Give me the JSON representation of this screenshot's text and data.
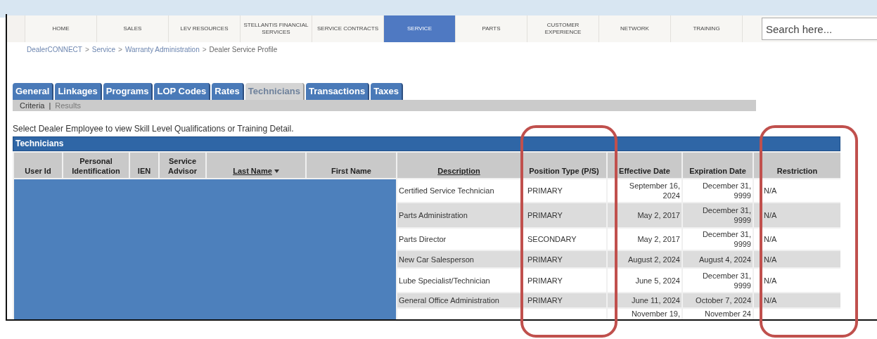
{
  "nav": {
    "items": [
      {
        "label": "HOME",
        "selected": false
      },
      {
        "label": "SALES",
        "selected": false
      },
      {
        "label": "LEV RESOURCES",
        "selected": false
      },
      {
        "label": "STELLANTIS FINANCIAL SERVICES",
        "selected": false
      },
      {
        "label": "SERVICE CONTRACTS",
        "selected": false
      },
      {
        "label": "SERVICE",
        "selected": true
      },
      {
        "label": "PARTS",
        "selected": false
      },
      {
        "label": "CUSTOMER EXPERIENCE",
        "selected": false
      },
      {
        "label": "NETWORK",
        "selected": false
      },
      {
        "label": "TRAINING",
        "selected": false
      }
    ],
    "search": {
      "placeholder": "Search here..."
    }
  },
  "breadcrumb": {
    "separator": ">",
    "items": [
      {
        "label": "DealerCONNECT",
        "kind": "link"
      },
      {
        "label": "Service",
        "kind": "link"
      },
      {
        "label": "Warranty Administration",
        "kind": "link"
      },
      {
        "label": "Dealer Service Profile",
        "kind": "current"
      }
    ]
  },
  "tabs": [
    {
      "label": "General",
      "selected": false
    },
    {
      "label": "Linkages",
      "selected": false
    },
    {
      "label": "Programs",
      "selected": false
    },
    {
      "label": "LOP Codes",
      "selected": false
    },
    {
      "label": "Rates",
      "selected": false
    },
    {
      "label": "Technicians",
      "selected": true
    },
    {
      "label": "Transactions",
      "selected": false
    },
    {
      "label": "Taxes",
      "selected": false
    }
  ],
  "subtabs": {
    "separator": "|",
    "items": [
      {
        "label": "Criteria",
        "selected": true
      },
      {
        "label": "Results",
        "selected": false
      }
    ]
  },
  "instruction": "Select Dealer Employee to view Skill Level Qualifications or Training Detail.",
  "table": {
    "title": "Technicians",
    "redacted": true,
    "columns": [
      {
        "label": "User Id",
        "kind": "plain",
        "sorted": false
      },
      {
        "label": "Personal Identification",
        "kind": "plain",
        "sorted": false
      },
      {
        "label": "IEN",
        "kind": "plain",
        "sorted": false
      },
      {
        "label": "Service Advisor",
        "kind": "plain",
        "sorted": false
      },
      {
        "label": "Last Name",
        "kind": "link",
        "sorted": true
      },
      {
        "label": "First Name",
        "kind": "plain",
        "sorted": false
      },
      {
        "label": "Description",
        "kind": "link",
        "sorted": false
      },
      {
        "label": "Position Type (P/S)",
        "kind": "plain",
        "sorted": false
      },
      {
        "label": "Effective Date",
        "kind": "plain",
        "sorted": false
      },
      {
        "label": "Expiration Date",
        "kind": "plain",
        "sorted": false
      },
      {
        "label": "Restriction",
        "kind": "plain",
        "sorted": false
      }
    ],
    "rows": [
      {
        "description": "Certified Service Technician",
        "position_type": "PRIMARY",
        "effective_date": "September 16, 2024",
        "expiration_date": "December 31, 9999",
        "restriction": "N/A"
      },
      {
        "description": "Parts Administration",
        "position_type": "PRIMARY",
        "effective_date": "May 2, 2017",
        "expiration_date": "December 31, 9999",
        "restriction": "N/A"
      },
      {
        "description": "Parts Director",
        "position_type": "SECONDARY",
        "effective_date": "May 2, 2017",
        "expiration_date": "December 31, 9999",
        "restriction": "N/A"
      },
      {
        "description": "New Car Salesperson",
        "position_type": "PRIMARY",
        "effective_date": "August 2, 2024",
        "expiration_date": "August 4, 2024",
        "restriction": "N/A"
      },
      {
        "description": "Lube Specialist/Technician",
        "position_type": "PRIMARY",
        "effective_date": "June 5, 2024",
        "expiration_date": "December 31, 9999",
        "restriction": "N/A"
      },
      {
        "description": "General Office Administration",
        "position_type": "PRIMARY",
        "effective_date": "June 11, 2024",
        "expiration_date": "October 7, 2024",
        "restriction": "N/A"
      },
      {
        "effective_date": "November 19,",
        "expiration_date": "November 24"
      }
    ]
  }
}
